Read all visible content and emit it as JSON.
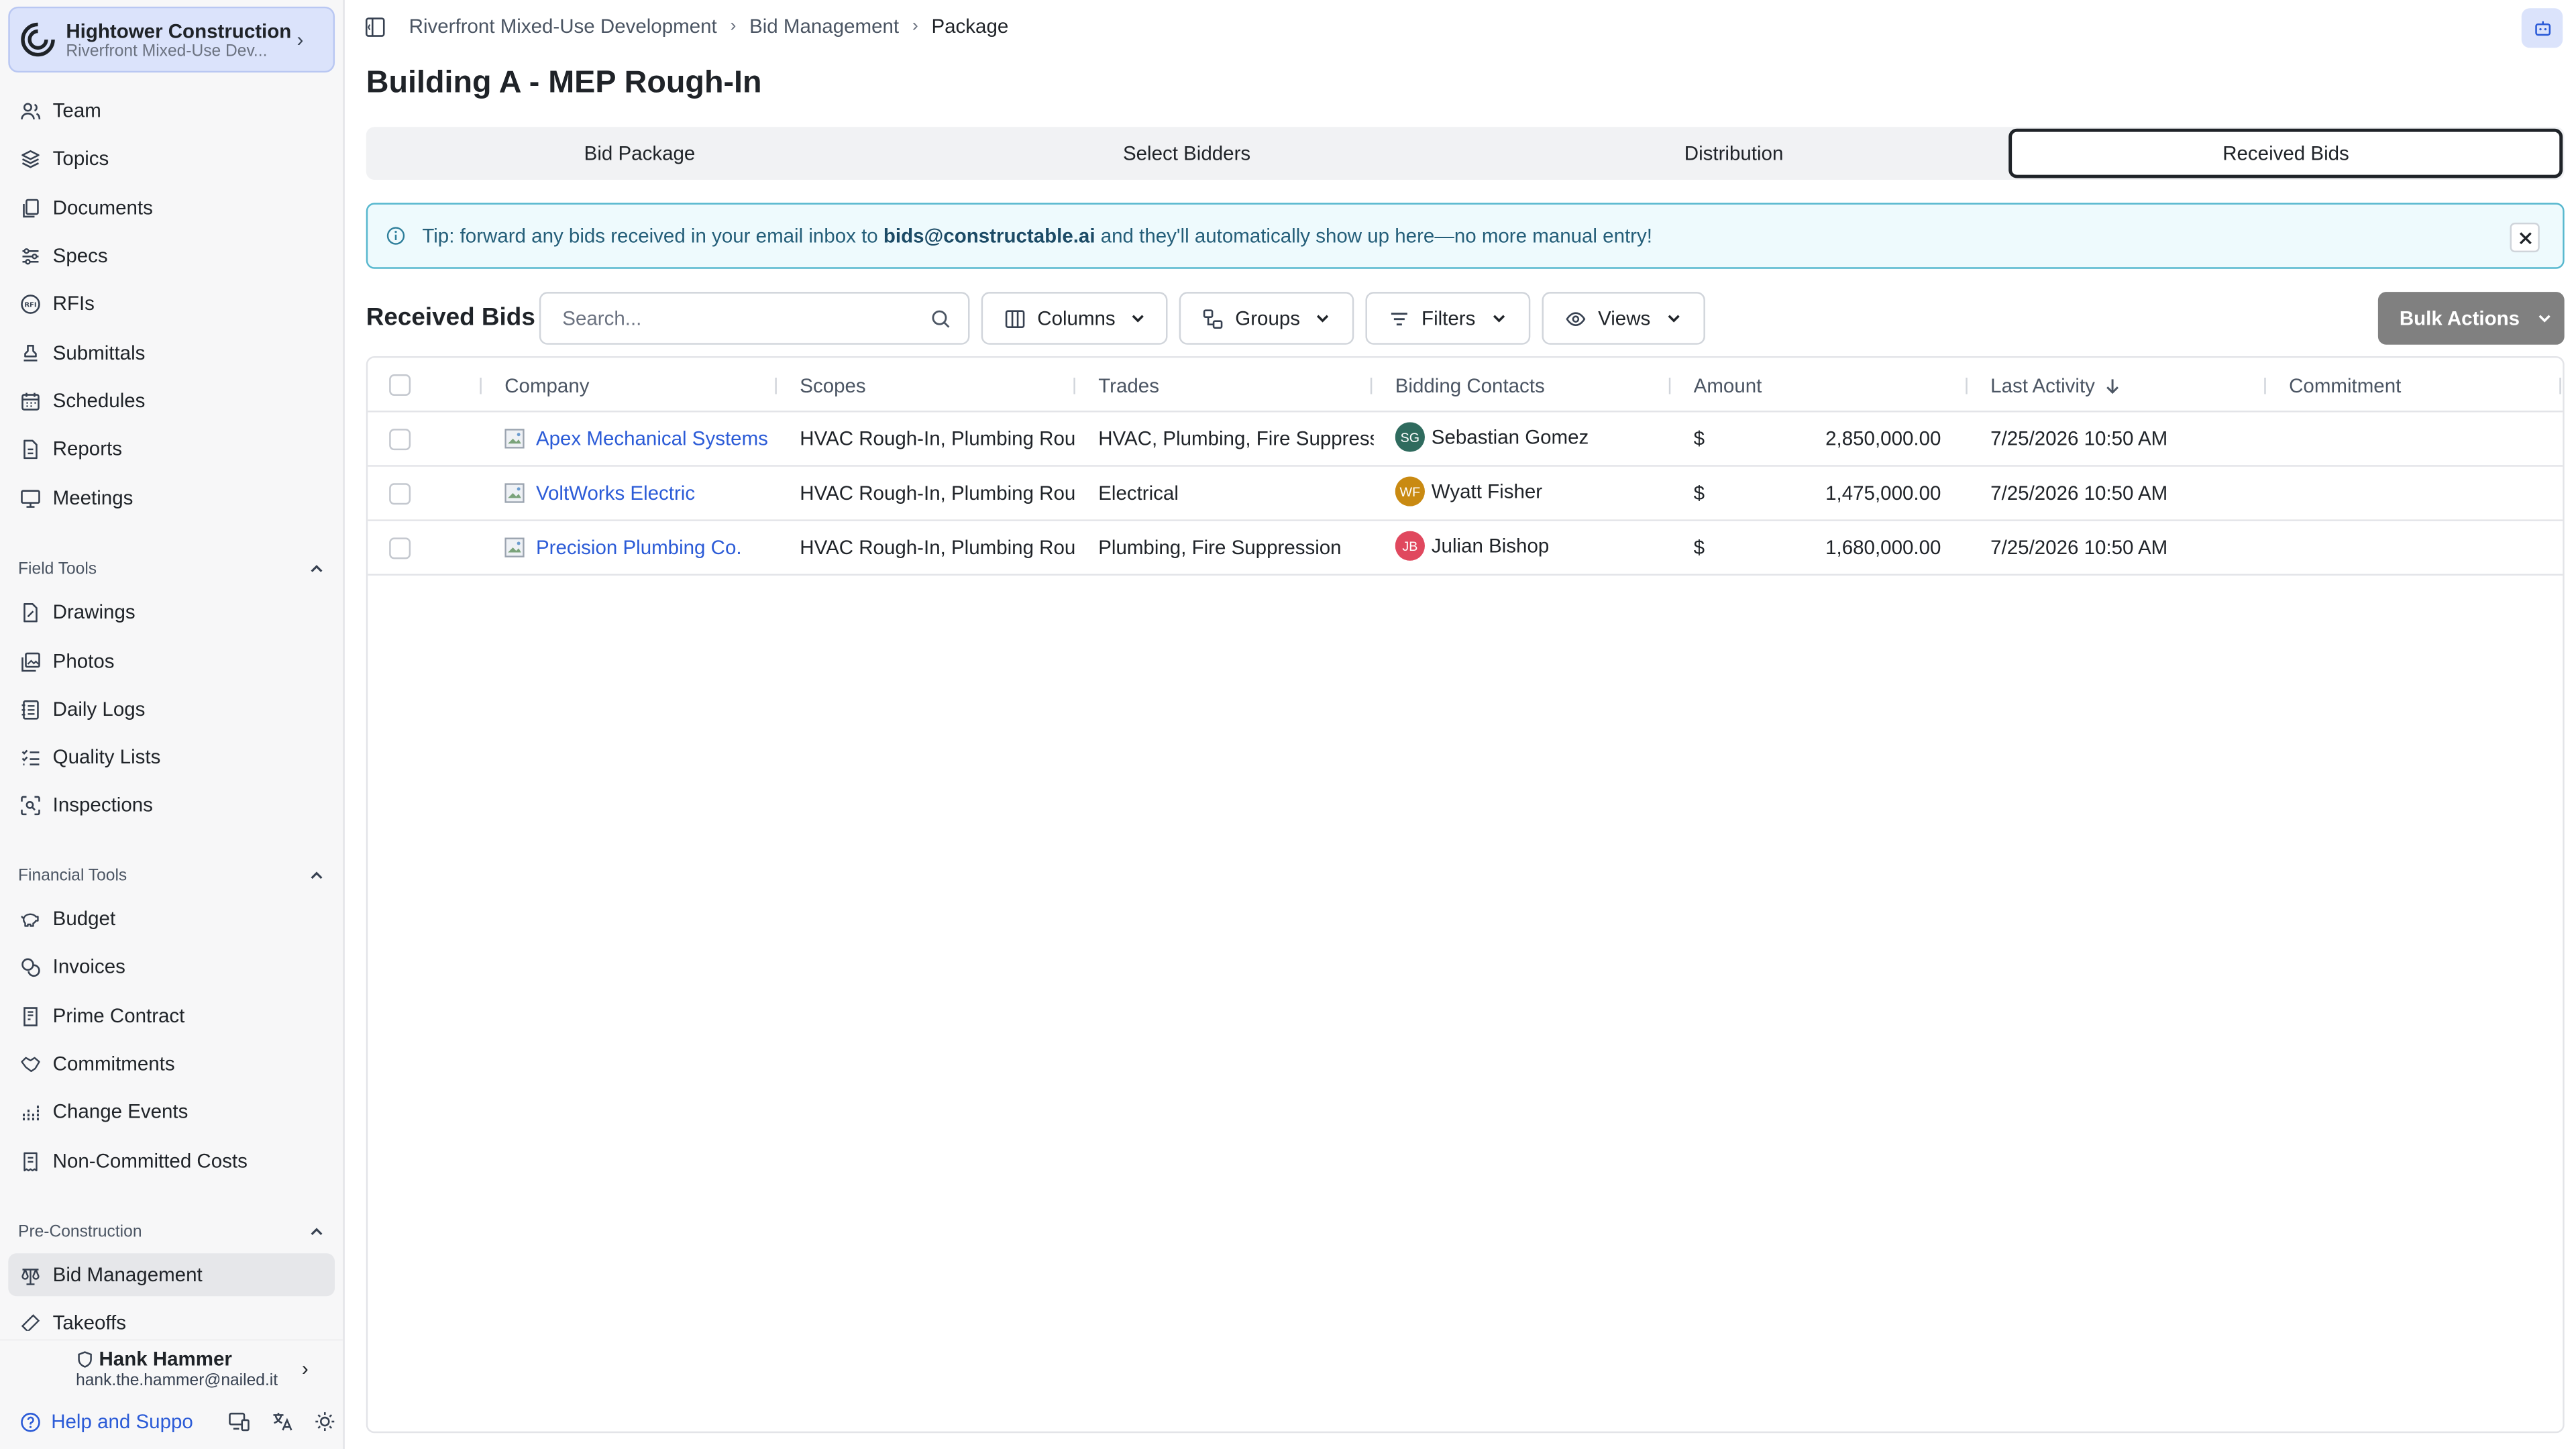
{
  "org": {
    "name": "Hightower Construction",
    "project": "Riverfront Mixed-Use Dev..."
  },
  "nav": {
    "main": [
      "Team",
      "Topics",
      "Documents",
      "Specs",
      "RFIs",
      "Submittals",
      "Schedules",
      "Reports",
      "Meetings"
    ],
    "sections": {
      "field": "Field Tools",
      "financial": "Financial Tools",
      "precon": "Pre-Construction"
    },
    "field": [
      "Drawings",
      "Photos",
      "Daily Logs",
      "Quality Lists",
      "Inspections"
    ],
    "financial": [
      "Budget",
      "Invoices",
      "Prime Contract",
      "Commitments",
      "Change Events",
      "Non-Committed Costs"
    ],
    "precon": [
      "Bid Management",
      "Takeoffs"
    ]
  },
  "user": {
    "name": "Hank Hammer",
    "email": "hank.the.hammer@nailed.it"
  },
  "footer": {
    "help": "Help and Suppo"
  },
  "breadcrumb": [
    "Riverfront Mixed-Use Development",
    "Bid Management",
    "Package"
  ],
  "page_title": "Building A - MEP Rough-In",
  "tabs": [
    "Bid Package",
    "Select Bidders",
    "Distribution",
    "Received Bids"
  ],
  "tip": {
    "before": "Tip: forward any bids received in your email inbox to ",
    "email": "bids@constructable.ai",
    "after": " and they'll automatically show up here—no more manual entry!"
  },
  "toolbar": {
    "title": "Received Bids",
    "search_placeholder": "Search...",
    "columns": "Columns",
    "groups": "Groups",
    "filters": "Filters",
    "views": "Views",
    "bulk": "Bulk Actions"
  },
  "table": {
    "headers": [
      "Company",
      "Scopes",
      "Trades",
      "Bidding Contacts",
      "Amount",
      "Last Activity",
      "Commitment"
    ],
    "rows": [
      {
        "company": "Apex Mechanical Systems",
        "scopes": "HVAC Rough-In, Plumbing Roug",
        "trades": "HVAC, Plumbing, Fire Suppressi",
        "initials": "SG",
        "contact": "Sebastian Gomez",
        "avatar_color": "#2f6b5e",
        "currency": "$",
        "amount": "2,850,000.00",
        "activity": "7/25/2026 10:50 AM"
      },
      {
        "company": "VoltWorks Electric",
        "scopes": "HVAC Rough-In, Plumbing Roug",
        "trades": "Electrical",
        "initials": "WF",
        "contact": "Wyatt Fisher",
        "avatar_color": "#c98a12",
        "currency": "$",
        "amount": "1,475,000.00",
        "activity": "7/25/2026 10:50 AM"
      },
      {
        "company": "Precision Plumbing Co.",
        "scopes": "HVAC Rough-In, Plumbing Roug",
        "trades": "Plumbing, Fire Suppression",
        "initials": "JB",
        "contact": "Julian Bishop",
        "avatar_color": "#e0485e",
        "currency": "$",
        "amount": "1,680,000.00",
        "activity": "7/25/2026 10:50 AM"
      }
    ]
  },
  "colors": {
    "accent": "#2b5bd7",
    "tip_bg": "#eefafd",
    "tip_border": "#56b7ce",
    "bulk_bg": "#808080"
  }
}
